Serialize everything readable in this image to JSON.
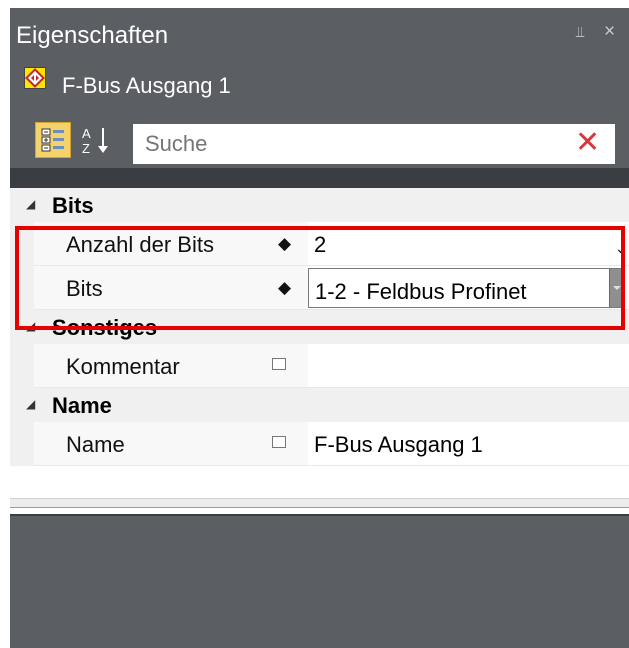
{
  "panel": {
    "title": "Eigenschaften",
    "pin_icon": "pin-icon",
    "close_icon": "close-icon",
    "pin_glyph": "⫫",
    "close_glyph": "×"
  },
  "object": {
    "name": "F-Bus Ausgang 1",
    "icon": "fieldbus-output-icon"
  },
  "toolbar": {
    "categorized_icon": "categorized-view-icon",
    "alphabetical_icon": "sort-alphabetical-icon",
    "search_placeholder": "Suche",
    "clear_glyph": "✕"
  },
  "categories": [
    {
      "label": "Bits",
      "rows": [
        {
          "name": "Anzahl der Bits",
          "value": "2",
          "editor": "spinner"
        },
        {
          "name": "Bits",
          "value": "1-2 - Feldbus Profinet",
          "editor": "dropdown"
        }
      ]
    },
    {
      "label": "Sonstiges",
      "rows": [
        {
          "name": "Kommentar",
          "value": ""
        }
      ]
    },
    {
      "label": "Name",
      "rows": [
        {
          "name": "Name",
          "value": "F-Bus Ausgang 1"
        }
      ]
    }
  ],
  "colors": {
    "panel_bg": "#5b5e63",
    "highlight": "#e60000",
    "clear_icon": "#d9383a",
    "toolbar_button_active": "#f4d36c"
  }
}
